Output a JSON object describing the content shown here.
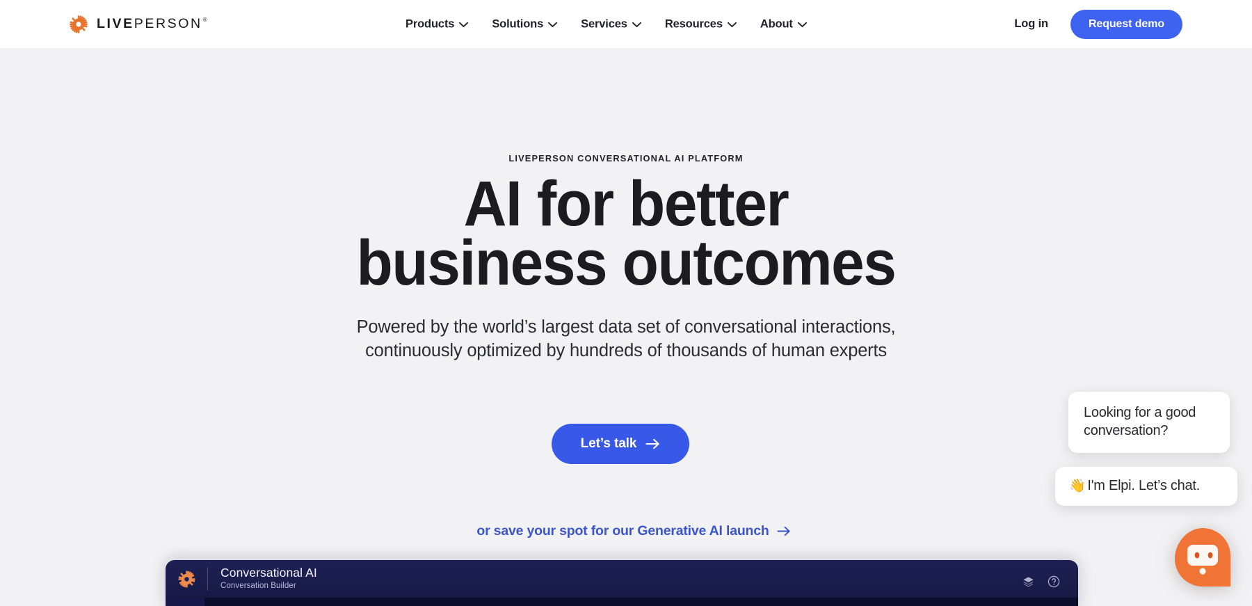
{
  "brand": {
    "name_bold": "LIVE",
    "name_light": "PERSON",
    "registered": "®",
    "logo_icon": "liveperson-gear-icon",
    "logo_color": "#e8722c"
  },
  "header": {
    "nav_items": [
      {
        "label": "Products",
        "icon": "chevron-down-icon"
      },
      {
        "label": "Solutions",
        "icon": "chevron-down-icon"
      },
      {
        "label": "Services",
        "icon": "chevron-down-icon"
      },
      {
        "label": "Resources",
        "icon": "chevron-down-icon"
      },
      {
        "label": "About",
        "icon": "chevron-down-icon"
      }
    ],
    "login_label": "Log in",
    "demo_label": "Request demo",
    "demo_color": "#3e63f0",
    "background": "#ffffff"
  },
  "hero": {
    "eyebrow": "LIVEPERSON CONVERSATIONAL AI PLATFORM",
    "headline_line1": "AI for better",
    "headline_line2": "business outcomes",
    "subhead_line1": "Powered by the world’s largest data set of conversational interactions,",
    "subhead_line2": "continuously optimized by hundreds of thousands of human experts",
    "cta_label": "Let’s talk",
    "cta_icon": "arrow-right-icon",
    "cta_color": "#3859e8",
    "secondary_link": "or save your spot for our Generative AI launch",
    "secondary_link_icon": "arrow-right-icon",
    "secondary_link_color": "#3c56c8",
    "background": "#f2f2f4"
  },
  "product_panel": {
    "logo_icon": "liveperson-gear-icon",
    "title": "Conversational AI",
    "subtitle": "Conversation Builder",
    "actions": [
      {
        "name": "layers-icon",
        "label": "Layers"
      },
      {
        "name": "help-circle-icon",
        "label": "Help"
      }
    ],
    "background": "#1e2055"
  },
  "chat_widget": {
    "bubble_1": "Looking for a good conversation?",
    "bubble_2_emoji": "👋",
    "bubble_2_text": "I'm Elpi. Let’s chat.",
    "launcher_icon": "elpi-chat-avatar-icon",
    "launcher_color": "#f07436"
  }
}
